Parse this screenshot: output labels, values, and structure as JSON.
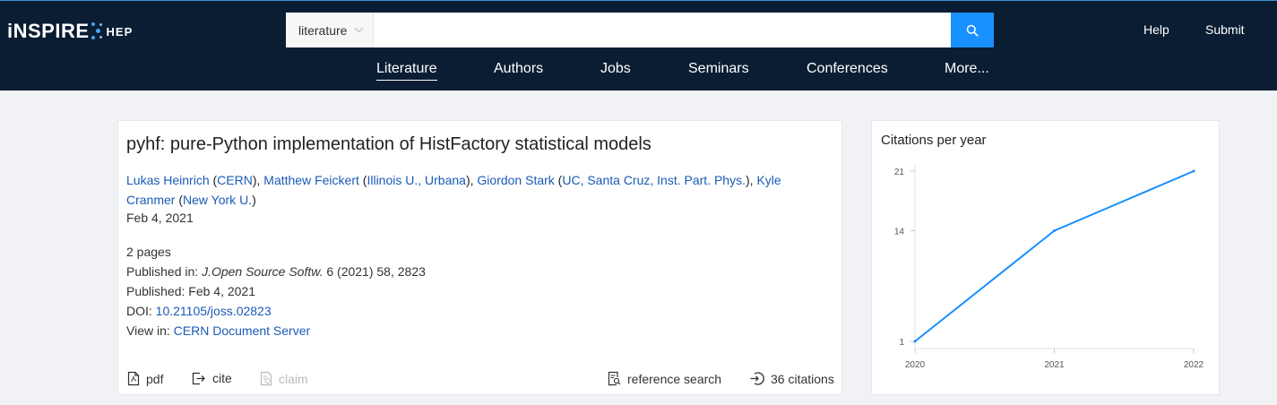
{
  "header": {
    "logo_main": "iNSPIRE",
    "logo_sub": "HEP",
    "search_scope": "literature",
    "search_value": "",
    "search_placeholder": "",
    "help": "Help",
    "submit": "Submit",
    "nav": [
      "Literature",
      "Authors",
      "Jobs",
      "Seminars",
      "Conferences",
      "More..."
    ],
    "active_nav": "Literature"
  },
  "record": {
    "title": "pyhf: pure-Python implementation of HistFactory statistical models",
    "authors": [
      {
        "name": "Lukas Heinrich",
        "affiliation": "CERN"
      },
      {
        "name": "Matthew Feickert",
        "affiliation": "Illinois U., Urbana"
      },
      {
        "name": "Giordon Stark",
        "affiliation": "UC, Santa Cruz, Inst. Part. Phys."
      },
      {
        "name": "Kyle Cranmer",
        "affiliation": "New York U."
      }
    ],
    "date": "Feb 4, 2021",
    "pages": "2 pages",
    "published_in_label": "Published in:",
    "journal": "J.Open Source Softw.",
    "journal_rest": "6 (2021) 58, 2823",
    "published_label": "Published:",
    "published_date": "Feb 4, 2021",
    "doi_label": "DOI:",
    "doi": "10.21105/joss.02823",
    "view_in_label": "View in:",
    "view_in": "CERN Document Server"
  },
  "actions": {
    "pdf": "pdf",
    "cite": "cite",
    "claim": "claim",
    "reference_search": "reference search",
    "citations": "36 citations"
  },
  "chart_data": {
    "type": "line",
    "title": "Citations per year",
    "x": [
      "2020",
      "2021",
      "2022"
    ],
    "values": [
      1,
      14,
      21
    ],
    "y_ticks": [
      1,
      14,
      21
    ],
    "ylim": [
      1,
      21
    ],
    "line_color": "#1890ff",
    "grid": false
  },
  "colors": {
    "header_bg": "#0b1d33",
    "accent": "#1890ff",
    "link": "#1a5bb6"
  }
}
